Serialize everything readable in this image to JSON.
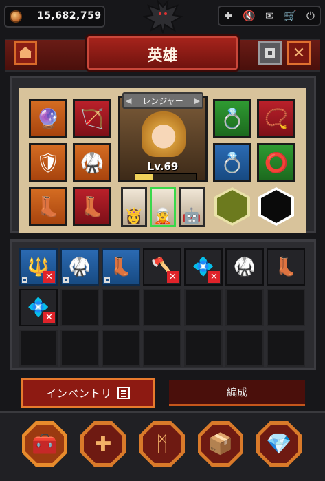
{
  "currency": {
    "icon": "gold-coin-icon",
    "amount": "15,682,759"
  },
  "top_icons": [
    "plus-icon",
    "mute-icon",
    "mail-icon",
    "cart-icon",
    "power-icon"
  ],
  "header": {
    "title": "英雄",
    "home_icon": "home-icon",
    "settings_icon": "settings-icon",
    "close_icon": "close-icon",
    "close_glyph": "✕"
  },
  "hero": {
    "class_label": "レンジャー",
    "prev_arrow": "◀",
    "next_arrow": "▶",
    "level": "Lv.69",
    "exp_fraction": 0.3
  },
  "equipment": {
    "left_slots": [
      {
        "name": "wand",
        "glyph": "🔮",
        "color": "orange"
      },
      {
        "name": "bow",
        "glyph": "🏹",
        "color": "red"
      },
      {
        "name": "armor",
        "glyph": "🛡",
        "color": "orange"
      },
      {
        "name": "chestplate",
        "glyph": "🥋",
        "color": "orange"
      },
      {
        "name": "boots-blue",
        "glyph": "👢",
        "color": "orange"
      },
      {
        "name": "boots-pink",
        "glyph": "👢",
        "color": "red"
      }
    ],
    "right_slots": [
      {
        "name": "ring",
        "glyph": "💍",
        "color": "green"
      },
      {
        "name": "necklace",
        "glyph": "📿",
        "color": "red"
      },
      {
        "name": "ring-gem",
        "glyph": "💍",
        "color": "blue"
      },
      {
        "name": "bracelet",
        "glyph": "⭕",
        "color": "green"
      }
    ],
    "heroes": [
      {
        "name": "cleric",
        "glyph": "👸",
        "selected": false
      },
      {
        "name": "ranger",
        "glyph": "🧝",
        "selected": true
      },
      {
        "name": "knight",
        "glyph": "🤖",
        "selected": false
      }
    ]
  },
  "inventory": {
    "items": [
      {
        "name": "staff",
        "glyph": "🔱",
        "style": "blue",
        "unusable": true
      },
      {
        "name": "armor",
        "glyph": "🥋",
        "style": "blue",
        "unusable": false
      },
      {
        "name": "boots",
        "glyph": "👢",
        "style": "blue",
        "unusable": false
      },
      {
        "name": "axe",
        "glyph": "🪓",
        "style": "dark",
        "unusable": true
      },
      {
        "name": "gem-badge",
        "glyph": "💠",
        "style": "dark",
        "unusable": true
      },
      {
        "name": "armor-dark",
        "glyph": "🥋",
        "style": "dark",
        "unusable": false
      },
      {
        "name": "boots-red",
        "glyph": "👢",
        "style": "dark",
        "unusable": false
      },
      {
        "name": "gem-badge-2",
        "glyph": "💠",
        "style": "dark",
        "unusable": true
      }
    ],
    "total_cells": 21,
    "unusable_mark": "✕"
  },
  "tabs": {
    "inventory": "インベントリ",
    "formation": "編成"
  },
  "bottom_nav": [
    {
      "name": "chest",
      "glyph": "🧰",
      "active": true
    },
    {
      "name": "cross",
      "glyph": "✚",
      "active": false
    },
    {
      "name": "rune",
      "glyph": "ᛗ",
      "active": false
    },
    {
      "name": "box",
      "glyph": "📦",
      "active": false
    },
    {
      "name": "crystal",
      "glyph": "💎",
      "active": false
    }
  ],
  "colors": {
    "accent_orange": "#e77a2d",
    "header_red": "#8d1a12",
    "select_green": "#3ad84a",
    "unusable_red": "#e0232a"
  }
}
